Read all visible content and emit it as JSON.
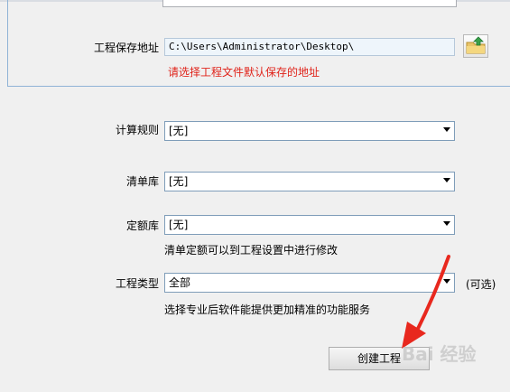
{
  "project_path": {
    "label": "工程保存地址",
    "value": "C:\\Users\\Administrator\\Desktop\\",
    "hint": "请选择工程文件默认保存的地址"
  },
  "calc_rule": {
    "label": "计算规则",
    "value": "[无]"
  },
  "bill_library": {
    "label": "清单库",
    "value": "[无]"
  },
  "quota_library": {
    "label": "定额库",
    "value": "[无]",
    "hint": "清单定额可以到工程设置中进行修改"
  },
  "project_type": {
    "label": "工程类型",
    "value": "全部",
    "optional": "(可选)",
    "hint": "选择专业后软件能提供更加精准的功能服务"
  },
  "create_button": {
    "label": "创建工程"
  },
  "watermark": {
    "text": "Bai 经验"
  },
  "icons": {
    "browse": "folder-up-icon",
    "annotation": "red-arrow-annotation"
  },
  "colors": {
    "hint_red": "#e0231a",
    "arrow_red": "#e8281e"
  }
}
